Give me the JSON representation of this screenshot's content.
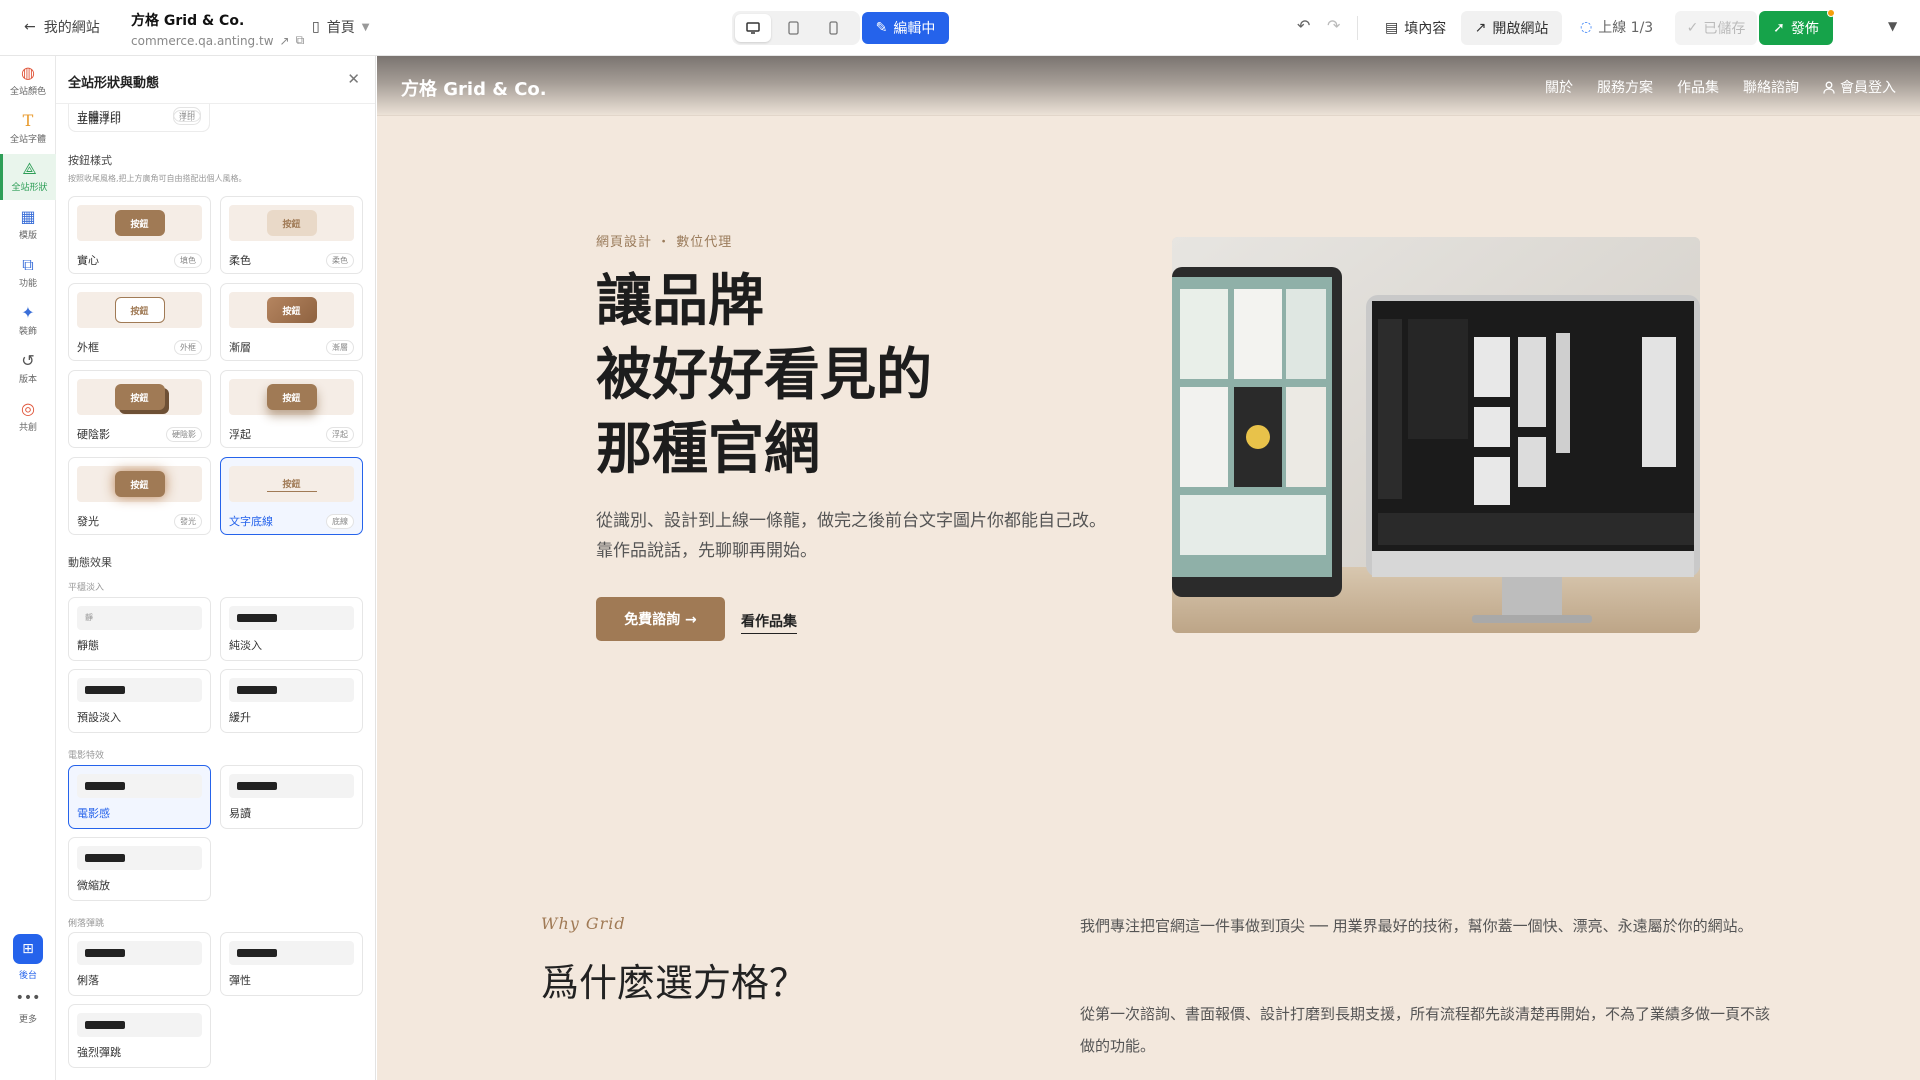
{
  "topbar": {
    "back_label": "我的網站",
    "site_name": "方格 Grid & Co.",
    "site_url": "commerce.qa.anting.tw",
    "page_label": "首頁",
    "edit_label": "編輯中",
    "fill_label": "填內容",
    "open_label": "開啟網站",
    "online_label": "上線 1/3",
    "saved_label": "已儲存",
    "publish_label": "發佈"
  },
  "rail": {
    "items": [
      {
        "label": "全站顏色",
        "icon": "palette-icon"
      },
      {
        "label": "全站字體",
        "icon": "text-icon"
      },
      {
        "label": "全站形狀",
        "icon": "shapes-icon"
      },
      {
        "label": "模版",
        "icon": "layout-icon"
      },
      {
        "label": "功能",
        "icon": "blocks-icon"
      },
      {
        "label": "裝飾",
        "icon": "sparkle-icon"
      },
      {
        "label": "版本",
        "icon": "history-icon"
      },
      {
        "label": "共創",
        "icon": "chat-icon"
      }
    ],
    "admin_label": "後台",
    "more_label": "更多"
  },
  "panel": {
    "title": "全站形狀與動態",
    "emboss": {
      "label": "立體浮印",
      "tag": "浮印"
    },
    "button_section": {
      "title": "按鈕樣式",
      "desc": "按照收尾風格,把上方廣角可自由搭配出個人風格。",
      "chip_label": "按鈕",
      "styles": [
        {
          "name": "實心",
          "tag": "填色"
        },
        {
          "name": "柔色",
          "tag": "柔色"
        },
        {
          "name": "外框",
          "tag": "外框"
        },
        {
          "name": "漸層",
          "tag": "漸層"
        },
        {
          "name": "硬陰影",
          "tag": "硬陰影"
        },
        {
          "name": "浮起",
          "tag": "浮起"
        },
        {
          "name": "發光",
          "tag": "發光"
        },
        {
          "name": "文字底線",
          "tag": "底線"
        }
      ]
    },
    "motion_section": {
      "title": "動態效果",
      "group1": "平穩淡入",
      "group2": "電影特效",
      "group3": "俐落彈跳",
      "static_sample": "靜",
      "items1": [
        "靜態",
        "純淡入",
        "預設淡入",
        "緩升"
      ],
      "items2": [
        "電影感",
        "易讀",
        "微縮放"
      ],
      "items3": [
        "俐落",
        "彈性",
        "強烈彈跳"
      ]
    }
  },
  "preview": {
    "brand": "方格 Grid & Co.",
    "nav": [
      "關於",
      "服務方案",
      "作品集",
      "聯絡諮詢",
      "會員登入"
    ],
    "eyebrow": "網頁設計 ・ 數位代理",
    "h1_line1": "讓品牌",
    "h1_line2": "被好好看見的",
    "h1_line3": "那種官網",
    "sub": "從識別、設計到上線一條龍，做完之後前台文字圖片你都能自己改。靠作品說話，先聊聊再開始。",
    "cta": "免費諮詢 →",
    "secondary": "看作品集",
    "why": "Why Grid",
    "h2": "爲什麼選方格？",
    "body1": "我們專注把官網這一件事做到頂尖 ── 用業界最好的技術，幫你蓋一個快、漂亮、永遠屬於你的網站。",
    "body2": "從第一次諮詢、書面報價、設計打磨到長期支援，所有流程都先談清楚再開始，不為了業績多做一頁不該做的功能。"
  }
}
